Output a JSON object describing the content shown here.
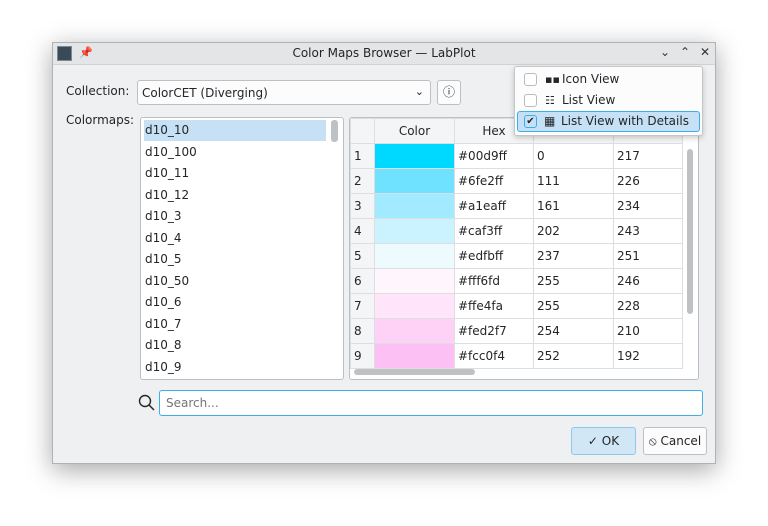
{
  "window": {
    "title": "Color Maps Browser — LabPlot",
    "controls": [
      "minimize",
      "maximize",
      "close"
    ]
  },
  "collection": {
    "label": "Collection:",
    "value": "ColorCET (Diverging)"
  },
  "colormaps": {
    "label": "Colormaps:",
    "items": [
      "d10_10",
      "d10_100",
      "d10_11",
      "d10_12",
      "d10_3",
      "d10_4",
      "d10_5",
      "d10_50",
      "d10_6",
      "d10_7",
      "d10_8",
      "d10_9"
    ],
    "selected": "d10_10"
  },
  "table": {
    "headers": [
      "Color",
      "Hex",
      "",
      ""
    ],
    "rows": [
      {
        "index": "1",
        "color": "#00d9ff",
        "hex": "#00d9ff",
        "c1": "0",
        "c2": "217"
      },
      {
        "index": "2",
        "color": "#6fe2ff",
        "hex": "#6fe2ff",
        "c1": "111",
        "c2": "226"
      },
      {
        "index": "3",
        "color": "#a1eaff",
        "hex": "#a1eaff",
        "c1": "161",
        "c2": "234"
      },
      {
        "index": "4",
        "color": "#caf3ff",
        "hex": "#caf3ff",
        "c1": "202",
        "c2": "243"
      },
      {
        "index": "5",
        "color": "#edfbff",
        "hex": "#edfbff",
        "c1": "237",
        "c2": "251"
      },
      {
        "index": "6",
        "color": "#fff6fd",
        "hex": "#fff6fd",
        "c1": "255",
        "c2": "246"
      },
      {
        "index": "7",
        "color": "#ffe4fa",
        "hex": "#ffe4fa",
        "c1": "255",
        "c2": "228"
      },
      {
        "index": "8",
        "color": "#fed2f7",
        "hex": "#fed2f7",
        "c1": "254",
        "c2": "210"
      },
      {
        "index": "9",
        "color": "#fcc0f4",
        "hex": "#fcc0f4",
        "c1": "252",
        "c2": "192"
      }
    ]
  },
  "search": {
    "placeholder": "Search..."
  },
  "view_menu": {
    "items": [
      {
        "label": "Icon View",
        "checked": false
      },
      {
        "label": "List View",
        "checked": false
      },
      {
        "label": "List View with Details",
        "checked": true
      }
    ]
  },
  "buttons": {
    "ok": "OK",
    "cancel": "Cancel"
  },
  "colors": {
    "accent": "#3daee9",
    "selection": "#c6e0f5"
  }
}
